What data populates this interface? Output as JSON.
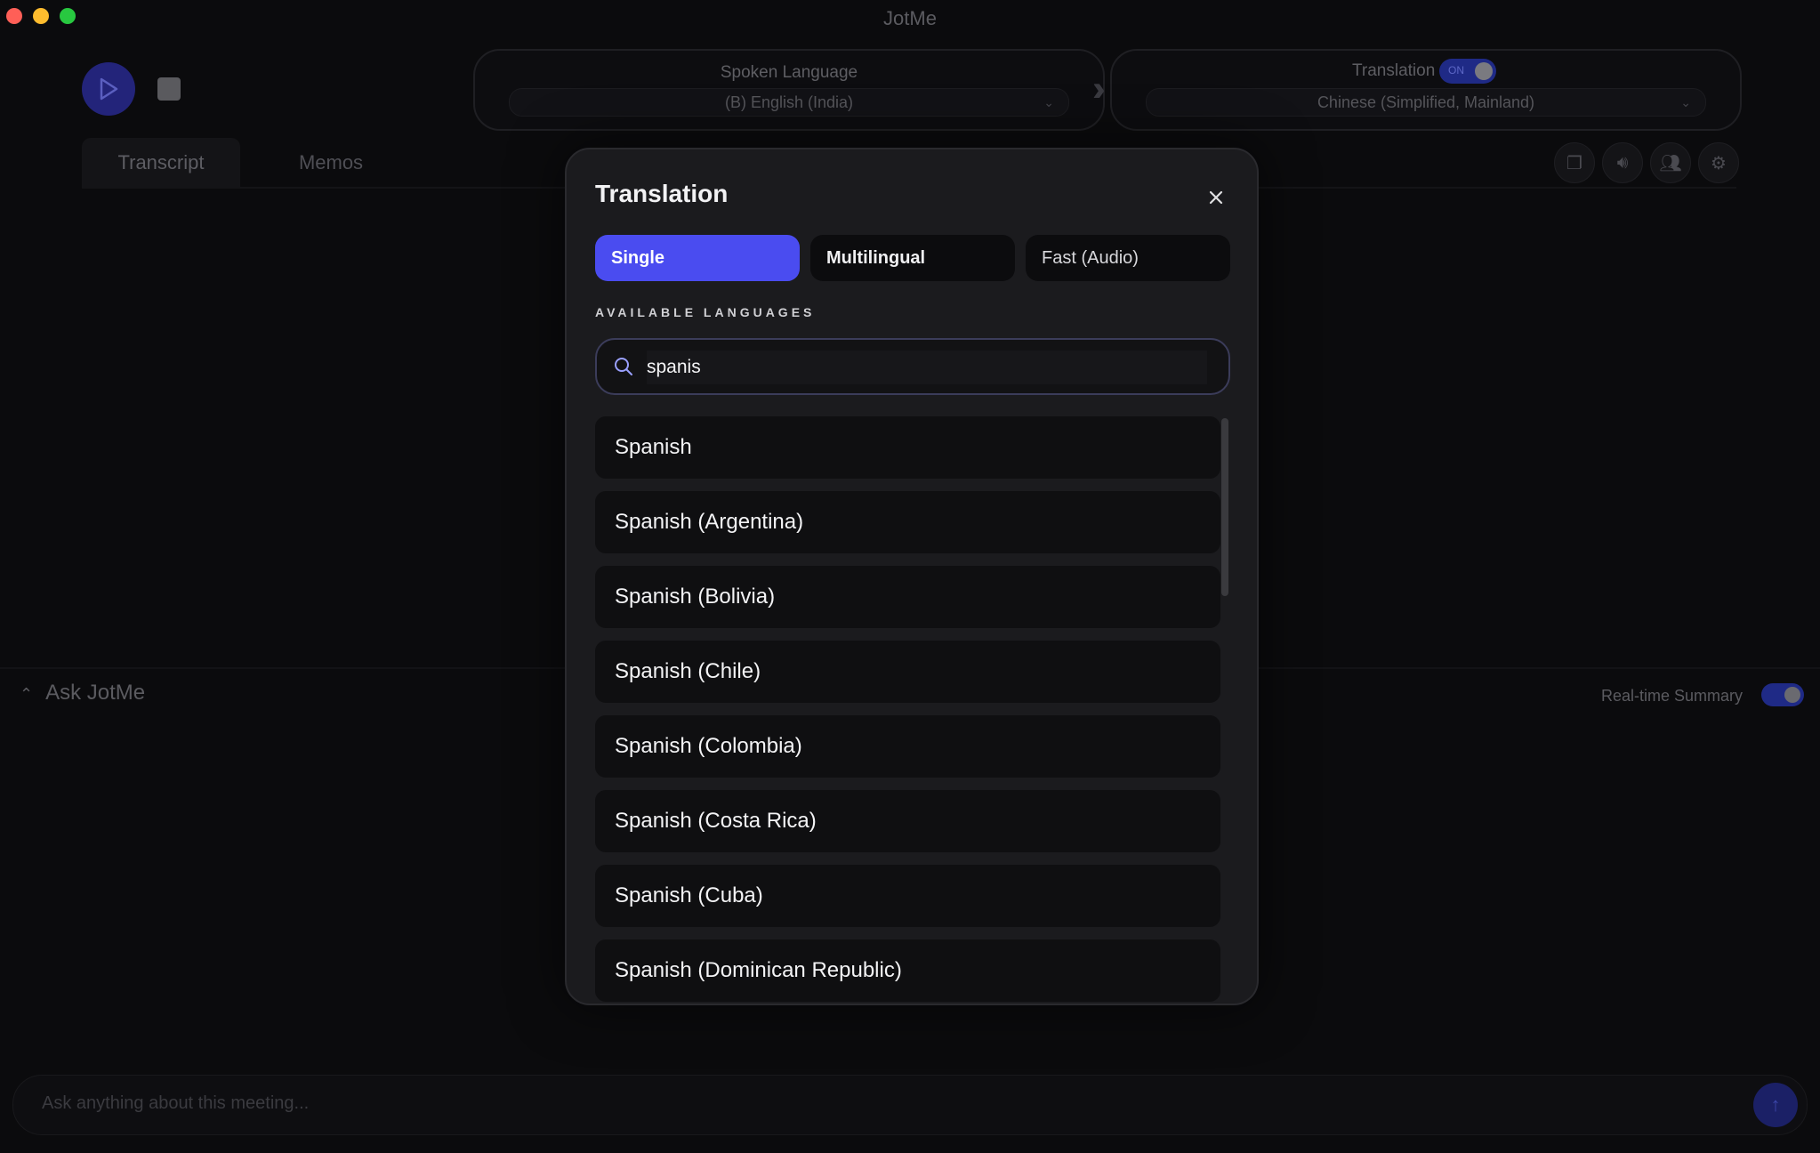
{
  "window": {
    "title": "JotMe"
  },
  "toolbar": {
    "play_icon": "play-icon",
    "stop_icon": "stop-icon"
  },
  "spoken": {
    "label": "Spoken Language",
    "value": "(B) English (India)"
  },
  "translation_card": {
    "label": "Translation",
    "toggle_text": "ON",
    "value": "Chinese (Simplified, Mainland)"
  },
  "tabs": [
    {
      "label": "Transcript"
    },
    {
      "label": "Memos"
    }
  ],
  "ask": {
    "title": "Ask JotMe",
    "realtime_label": "Real-time Summary",
    "input_placeholder": "Ask anything about this meeting..."
  },
  "modal": {
    "title": "Translation",
    "modes": [
      {
        "label": "Single"
      },
      {
        "label": "Multilingual"
      },
      {
        "label": "Fast (Audio)"
      }
    ],
    "available_label": "AVAILABLE LANGUAGES",
    "search_value": "spanis",
    "languages": [
      "Spanish",
      "Spanish (Argentina)",
      "Spanish (Bolivia)",
      "Spanish (Chile)",
      "Spanish (Colombia)",
      "Spanish (Costa Rica)",
      "Spanish (Cuba)",
      "Spanish (Dominican Republic)"
    ]
  },
  "colors": {
    "accent": "#4a4cf0",
    "background": "#0b0b0d",
    "modal": "#1b1b1e"
  }
}
